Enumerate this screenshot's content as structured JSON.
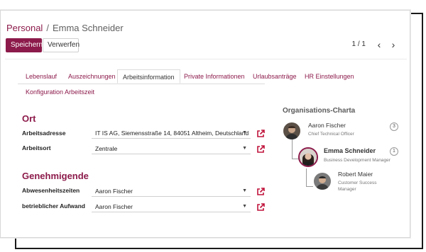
{
  "breadcrumb": {
    "parent": "Personal",
    "separator": "/",
    "current": "Emma Schneider"
  },
  "actions": {
    "save_label": "Speichern",
    "discard_label": "Verwerfen"
  },
  "pager": {
    "value": "1 / 1",
    "prev_icon": "chevron-left-icon",
    "next_icon": "chevron-right-icon"
  },
  "tabs": [
    {
      "label": "Lebenslauf",
      "active": false
    },
    {
      "label": "Auszeichnungen",
      "active": false
    },
    {
      "label": "Arbeitsinformation",
      "active": true
    },
    {
      "label": "Private Informationen",
      "active": false
    },
    {
      "label": "Urlaubsanträge",
      "active": false
    },
    {
      "label": "HR Einstellungen",
      "active": false
    },
    {
      "label": "Konfiguration Arbeitszeit",
      "active": false
    }
  ],
  "location": {
    "title": "Ort",
    "fields": [
      {
        "label": "Arbeitsadresse",
        "value": "IT IS AG, Siemensstraße 14, 84051 Altheim, Deutschland"
      },
      {
        "label": "Arbeitsort",
        "value": "Zentrale"
      }
    ]
  },
  "approvers": {
    "title": "Genehmigende",
    "fields": [
      {
        "label": "Abwesenheitszeiten",
        "value": "Aaron Fischer"
      },
      {
        "label": "betrieblicher Aufwand",
        "value": "Aaron Fischer"
      }
    ]
  },
  "org_chart": {
    "title": "Organisations-Charta",
    "people": [
      {
        "name": "Aaron Fischer",
        "role": "Chief Technical Officer",
        "count": "3"
      },
      {
        "name": "Emma Schneider",
        "role": "Business Development Manager",
        "count": "1"
      },
      {
        "name": "Robert Maier",
        "role": "Customer Success Manager",
        "count": ""
      }
    ]
  },
  "colors": {
    "accent": "#8c1a4a",
    "ext_link": "#c0133b"
  },
  "icons": {
    "dropdown": "caret-down-icon",
    "external": "external-link-icon"
  }
}
